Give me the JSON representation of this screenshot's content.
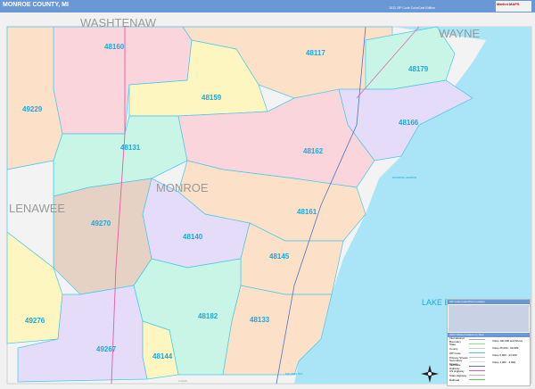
{
  "header": {
    "title": "MONROE COUNTY, MI",
    "edition": "2022 ZIP Code ColorCast Edition",
    "logo": "Market MAPS"
  },
  "counties": [
    "WASHTENAW",
    "WAYNE",
    "LENAWEE",
    "MONROE"
  ],
  "water": {
    "lake": "LAKE ERIE",
    "harbor": "MONROE HARBOR",
    "bay": "MAUMEE BAY",
    "road": "LUCAS"
  },
  "zips": [
    {
      "code": "48160",
      "color": "#fbd5dc"
    },
    {
      "code": "48117",
      "color": "#fde0c8"
    },
    {
      "code": "48179",
      "color": "#c8f5e6"
    },
    {
      "code": "48159",
      "color": "#fdf6c0"
    },
    {
      "code": "49229",
      "color": "#fde0c8"
    },
    {
      "code": "48166",
      "color": "#e4dcf8"
    },
    {
      "code": "48131",
      "color": "#c8f5e6"
    },
    {
      "code": "48162",
      "color": "#fbd5dc"
    },
    {
      "code": "48161",
      "color": "#fde0c8"
    },
    {
      "code": "48140",
      "color": "#e4dcf8"
    },
    {
      "code": "49270",
      "color": "#e6d2c4"
    },
    {
      "code": "48145",
      "color": "#fde0c8"
    },
    {
      "code": "49276",
      "color": "#fdf6c0"
    },
    {
      "code": "48182",
      "color": "#c8f5e6"
    },
    {
      "code": "48133",
      "color": "#fde0c8"
    },
    {
      "code": "49267",
      "color": "#e4dcf8"
    },
    {
      "code": "48144",
      "color": "#fdf6c0"
    }
  ],
  "legend": {
    "title": "ZIP Code Index/Post Location",
    "subtitle": "2022 Market Feature by Map",
    "items": [
      "International Boundary",
      "State",
      "County",
      "ZIP Code",
      "Primary Streets",
      "Secondary Streets",
      "Interstate Highway",
      "US Highway",
      "State Highway",
      "Railroad"
    ],
    "cities": [
      "Cities 100,000 and Above",
      "Cities 25,000 - 99,999",
      "Cities 5,000 - 24,999",
      "Cities 1,000 - 4,999"
    ]
  },
  "colors": {
    "header": "#6a97d6",
    "water": "#a9e4f7",
    "zip_label": "#19a9e0"
  }
}
